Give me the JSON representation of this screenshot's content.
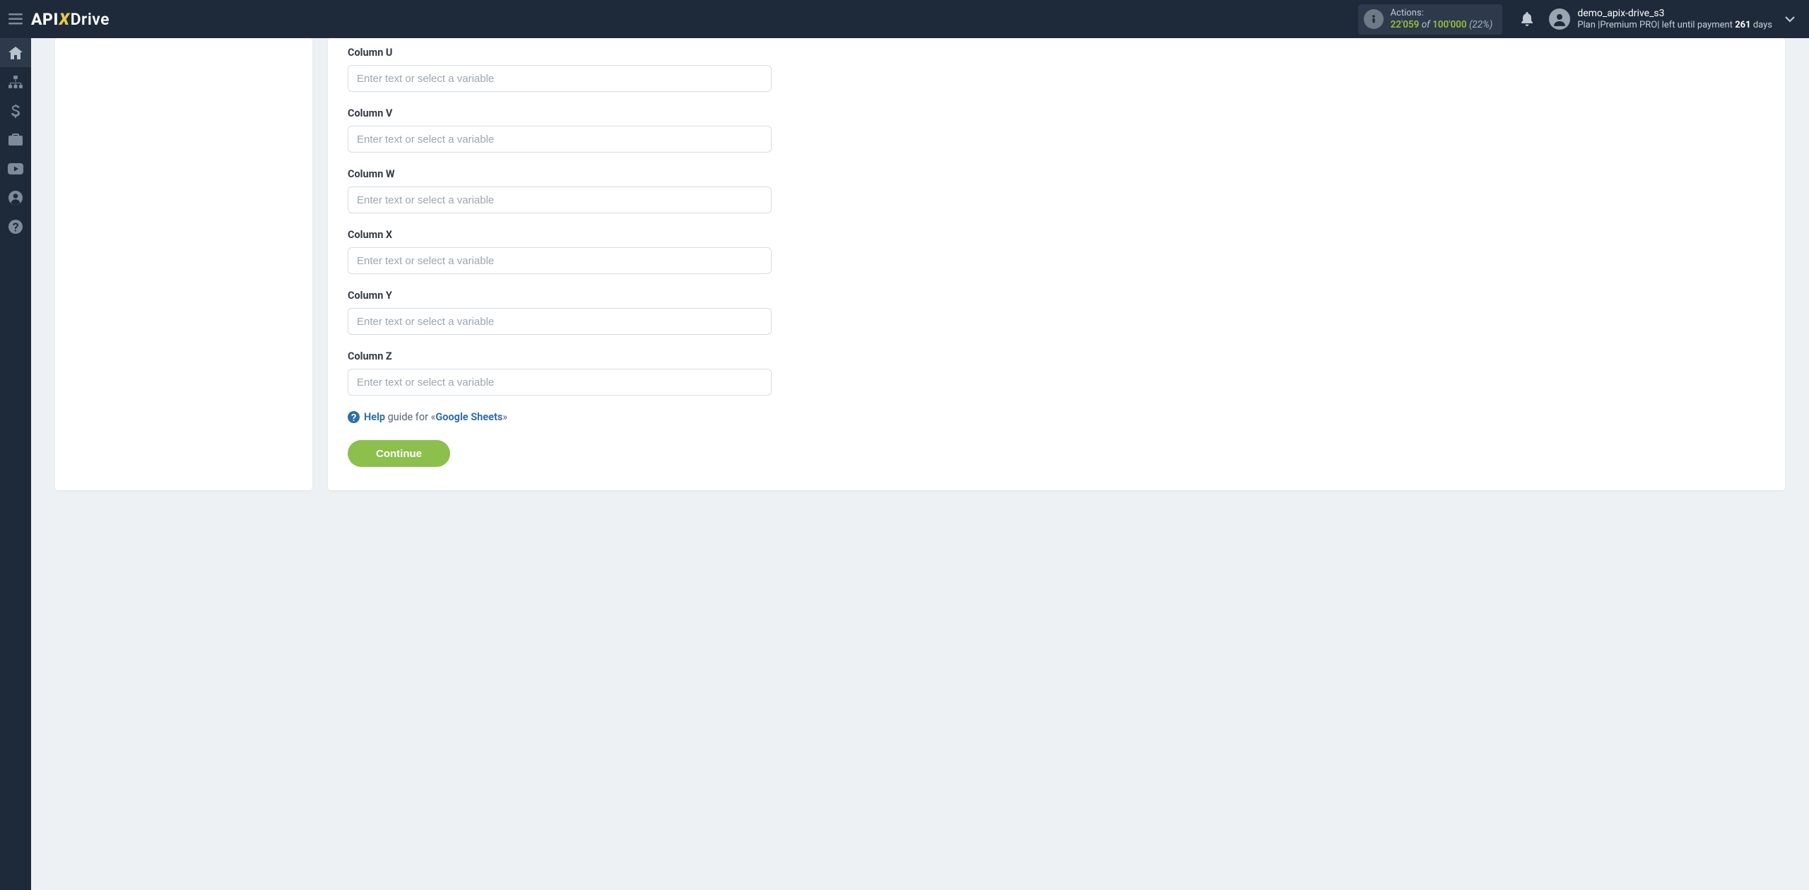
{
  "brand": {
    "part1": "API",
    "part2": "X",
    "part3": "Drive"
  },
  "actions": {
    "label": "Actions:",
    "used": "22'059",
    "of": "of",
    "total": "100'000",
    "pct": "(22%)"
  },
  "user": {
    "name": "demo_apix-drive_s3",
    "plan_prefix": "Plan |",
    "plan_name": "Premium PRO",
    "plan_mid": "| left until payment ",
    "days_num": "261",
    "plan_suffix": " days"
  },
  "fields": [
    {
      "label": "Column U",
      "placeholder": "Enter text or select a variable"
    },
    {
      "label": "Column V",
      "placeholder": "Enter text or select a variable"
    },
    {
      "label": "Column W",
      "placeholder": "Enter text or select a variable"
    },
    {
      "label": "Column X",
      "placeholder": "Enter text or select a variable"
    },
    {
      "label": "Column Y",
      "placeholder": "Enter text or select a variable"
    },
    {
      "label": "Column Z",
      "placeholder": "Enter text or select a variable"
    }
  ],
  "help": {
    "word": "Help",
    "mid": " guide for «",
    "subject": "Google Sheets",
    "end": "»"
  },
  "continue": "Continue"
}
